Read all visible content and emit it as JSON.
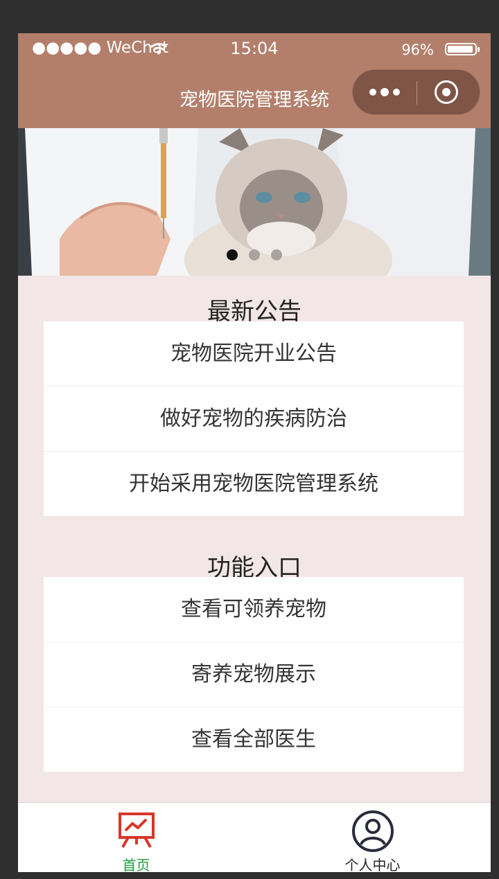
{
  "status_bar": {
    "carrier": "●●●●● WeChat",
    "time": "15:04",
    "battery_text": "96%",
    "battery_level": 0.96
  },
  "nav": {
    "title": "宠物医院管理系统"
  },
  "banner": {
    "slide_count": 3,
    "active_index": 0
  },
  "announcements": {
    "title": "最新公告",
    "items": [
      "宠物医院开业公告",
      "做好宠物的疾病防治",
      "开始采用宠物医院管理系统"
    ]
  },
  "functions": {
    "title": "功能入口",
    "items": [
      "查看可领养宠物",
      "寄养宠物展示",
      "查看全部医生"
    ]
  },
  "tabbar": {
    "tabs": [
      {
        "label": "首页",
        "icon": "presentation-chart-icon",
        "active": true
      },
      {
        "label": "个人中心",
        "icon": "user-circle-icon",
        "active": false
      }
    ]
  },
  "colors": {
    "brand": "#b37f6b",
    "capsule": "#7e5546",
    "page_bg": "#f2e6e7",
    "active_tab": "#1a9c3a",
    "home_icon": "#d9352a"
  }
}
